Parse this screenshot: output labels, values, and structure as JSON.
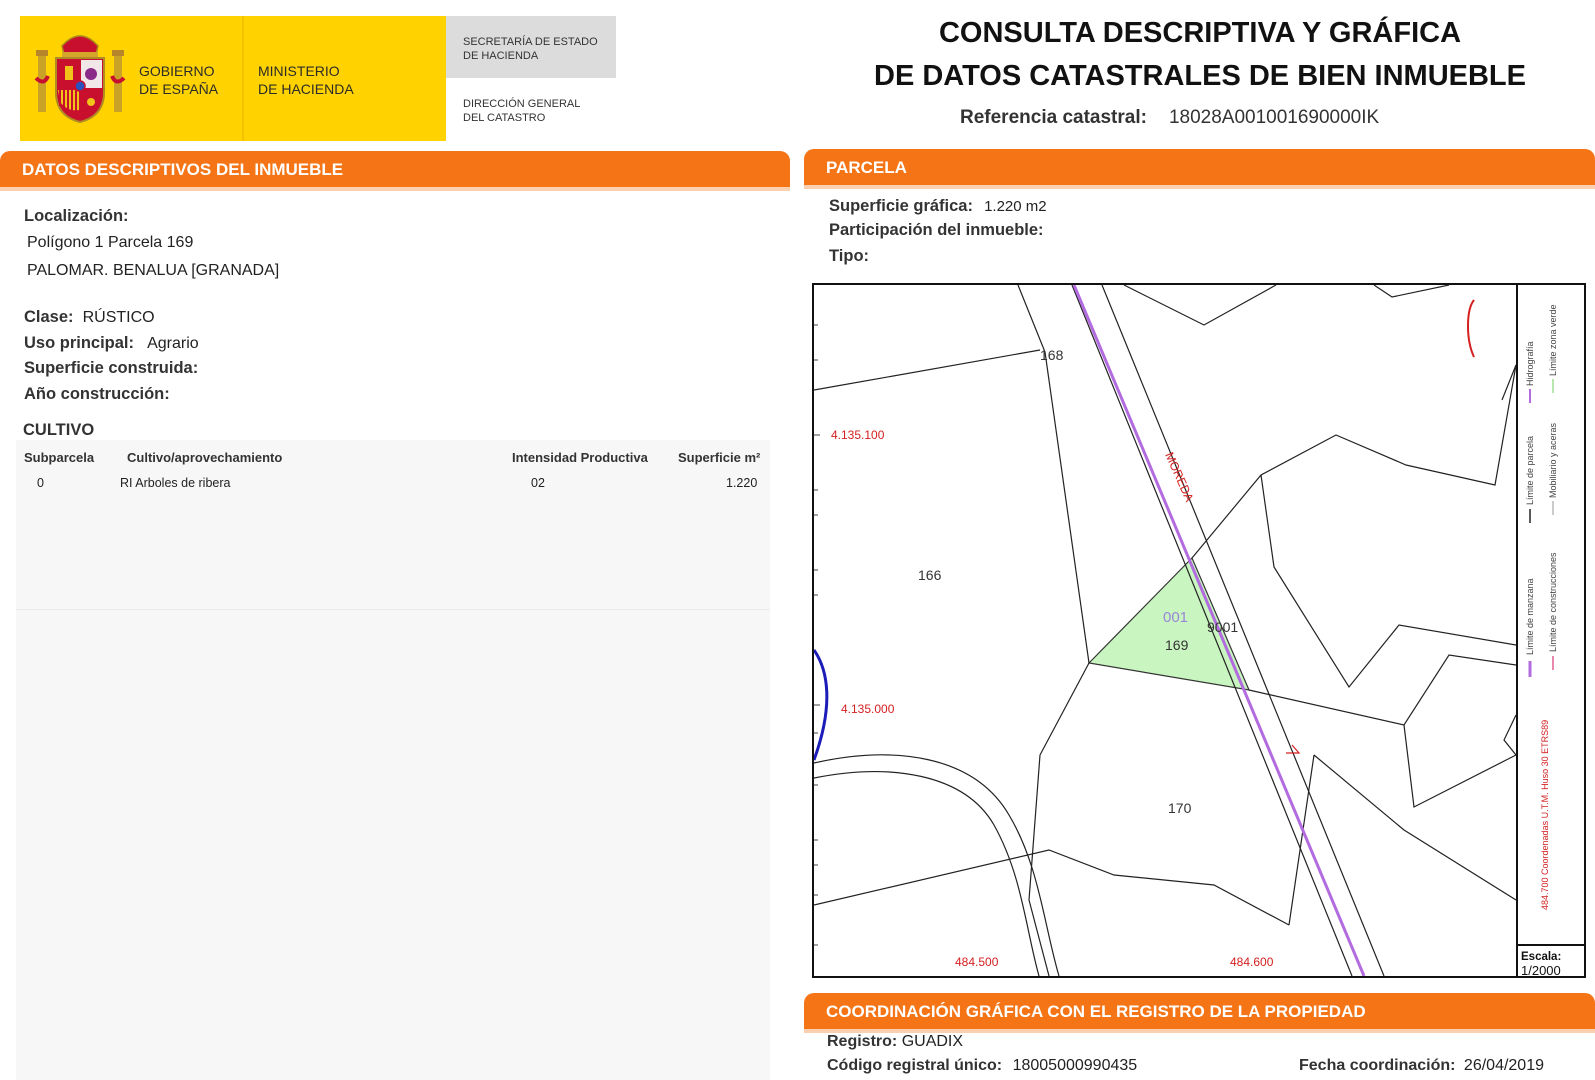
{
  "header": {
    "gov_line1": "GOBIERNO",
    "gov_line2": "DE ESPAÑA",
    "min_line1": "MINISTERIO",
    "min_line2": "DE HACIENDA",
    "sec_line1": "SECRETARÍA DE ESTADO",
    "sec_line2": "DE HACIENDA",
    "dir_line1": "DIRECCIÓN GENERAL",
    "dir_line2": "DEL CATASTRO",
    "title_line1": "CONSULTA DESCRIPTIVA Y GRÁFICA",
    "title_line2": "DE DATOS CATASTRALES DE BIEN INMUEBLE",
    "ref_label": "Referencia catastral:",
    "ref_value": "18028A001001690000IK"
  },
  "descriptivos": {
    "section_title": "DATOS DESCRIPTIVOS DEL INMUEBLE",
    "localizacion_label": "Localización:",
    "localizacion_line1": "Polígono 1 Parcela 169",
    "localizacion_line2": "PALOMAR. BENALUA [GRANADA]",
    "clase_label": "Clase:",
    "clase_value": "RÚSTICO",
    "uso_label": "Uso principal:",
    "uso_value": "Agrario",
    "sup_construida_label": "Superficie construida:",
    "anio_label": "Año construcción:"
  },
  "cultivo": {
    "title": "CULTIVO",
    "headers": [
      "Subparcela",
      "Cultivo/aprovechamiento",
      "Intensidad Productiva",
      "Superficie m²"
    ],
    "rows": [
      [
        "0",
        "RI Arboles de ribera",
        "02",
        "1.220"
      ]
    ]
  },
  "parcela": {
    "section_title": "PARCELA",
    "sup_grafica_label": "Superficie gráfica:",
    "sup_grafica_value": "1.220 m2",
    "participacion_label": "Participación del inmueble:",
    "tipo_label": "Tipo:"
  },
  "map": {
    "labels": {
      "parcel_166": "166",
      "parcel_168": "168",
      "parcel_169": "169",
      "parcel_170": "170",
      "subparcel_001": "001",
      "road_9001": "9001",
      "road_name": "MOREDA",
      "coord_y1": "4.135.100",
      "coord_y2": "4.135.000",
      "coord_x1": "484.500",
      "coord_x2": "484.600"
    },
    "legend": {
      "hidrografia": "Hidrografía",
      "limite_zona_verde": "Límite zona verde",
      "limite_parcela": "Límite de parcela",
      "mobiliario": "Mobiliario y aceras",
      "limite_manzana": "Límite de manzana",
      "limite_construcciones": "Límite de construcciones",
      "coords_note": "484.700 Coordenadas U.T.M. Huso 30 ETRS89"
    },
    "scale_label": "Escala:",
    "scale_value": "1/2000",
    "colors": {
      "parcel_fill": "#c8f5c0",
      "road_line": "#b36be0",
      "river": "#1c1cb8",
      "coords": "#d42020"
    }
  },
  "coordinacion": {
    "section_title": "COORDINACIÓN GRÁFICA CON EL REGISTRO DE LA PROPIEDAD",
    "registro_label": "Registro:",
    "registro_value": "GUADIX",
    "codigo_label": "Código registral único:",
    "codigo_value": "18005000990435",
    "fecha_label": "Fecha coordinación:",
    "fecha_value": "26/04/2019"
  }
}
